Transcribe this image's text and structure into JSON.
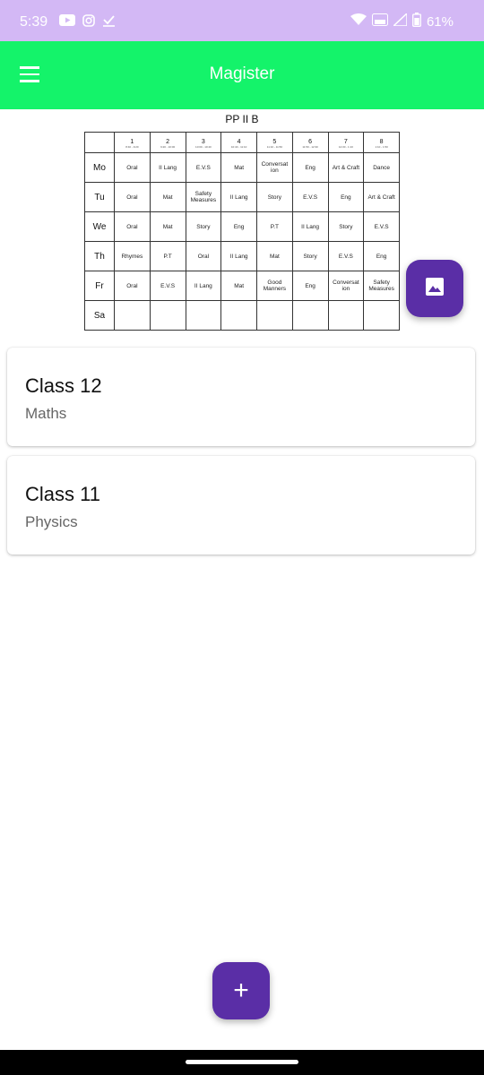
{
  "status_bar": {
    "time": "5:39",
    "battery": "61%",
    "left_icons": [
      "youtube-icon",
      "instagram-icon",
      "check-icon"
    ],
    "right_icons": [
      "wifi-icon",
      "volte-icon",
      "signal-icon",
      "battery-icon"
    ]
  },
  "app_bar": {
    "title": "Magister"
  },
  "timetable": {
    "title": "PP II B",
    "periods": [
      {
        "num": "1",
        "time": "8:40 - 9:20"
      },
      {
        "num": "2",
        "time": "9:20 - 10:00"
      },
      {
        "num": "3",
        "time": "10:00 - 10:40"
      },
      {
        "num": "4",
        "time": "10:40 - 11:10"
      },
      {
        "num": "5",
        "time": "11:10 - 11:50"
      },
      {
        "num": "6",
        "time": "11:50 - 12:30"
      },
      {
        "num": "7",
        "time": "12:30 - 1:10"
      },
      {
        "num": "8",
        "time": "1:10 - 1:50"
      }
    ],
    "days": [
      {
        "day": "Mo",
        "subjects": [
          "Oral",
          "II Lang",
          "E.V.S",
          "Mat",
          "Conversat ion",
          "Eng",
          "Art & Craft",
          "Dance"
        ]
      },
      {
        "day": "Tu",
        "subjects": [
          "Oral",
          "Mat",
          "Safety Measures",
          "II Lang",
          "Story",
          "E.V.S",
          "Eng",
          "Art & Craft"
        ]
      },
      {
        "day": "We",
        "subjects": [
          "Oral",
          "Mat",
          "Story",
          "Eng",
          "P.T",
          "II Lang",
          "Story",
          "E.V.S"
        ]
      },
      {
        "day": "Th",
        "subjects": [
          "Rhymes",
          "P.T",
          "Oral",
          "II Lang",
          "Mat",
          "Story",
          "E.V.S",
          "Eng"
        ]
      },
      {
        "day": "Fr",
        "subjects": [
          "Oral",
          "E.V.S",
          "II Lang",
          "Mat",
          "Good Manners",
          "Eng",
          "Conversat ion",
          "Safety Measures"
        ]
      },
      {
        "day": "Sa",
        "subjects": [
          "",
          "",
          "",
          "",
          "",
          "",
          "",
          ""
        ]
      }
    ]
  },
  "cards": [
    {
      "title": "Class 12",
      "subtitle": "Maths"
    },
    {
      "title": "Class 11",
      "subtitle": "Physics"
    }
  ],
  "fab_add": {
    "label": "+"
  },
  "colors": {
    "status_bar": "#d3b8f5",
    "app_bar": "#14f36a",
    "fab": "#5a2ea6"
  }
}
